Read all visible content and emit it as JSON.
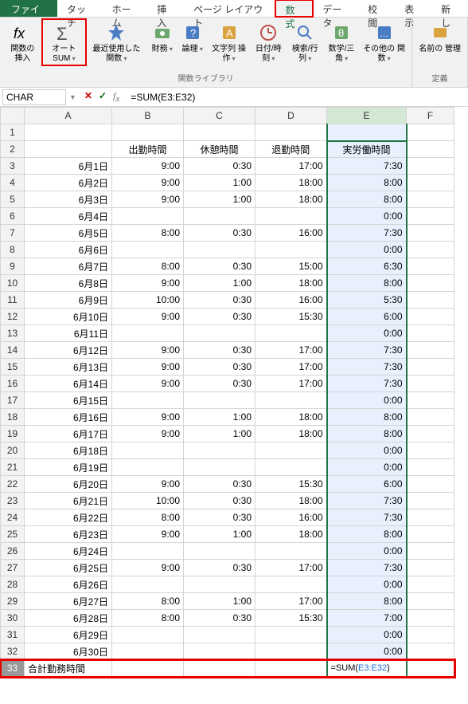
{
  "tabs": {
    "file": "ファイル",
    "touch": "タッチ",
    "home": "ホーム",
    "insert": "挿入",
    "pagelayout": "ページ レイアウト",
    "formulas": "数式",
    "data": "データ",
    "review": "校閲",
    "view": "表示",
    "new": "新し"
  },
  "ribbon": {
    "insert_fn": "関数の\n挿入",
    "autosum": "オート\nSUM",
    "recent": "最近使用した\n関数",
    "finance": "財務",
    "logic": "論理",
    "text": "文字列\n操作",
    "date": "日付/時刻",
    "lookup": "検索/行列",
    "math": "数学/三角",
    "other": "その他の\n関数",
    "name_mgr": "名前の\n管理",
    "define": "定義",
    "group_label": "関数ライブラリ"
  },
  "fbar": {
    "namebox": "CHAR",
    "formula": "=SUM(E3:E32)"
  },
  "cols": {
    "A": "A",
    "B": "B",
    "C": "C",
    "D": "D",
    "E": "E",
    "F": "F"
  },
  "headers": {
    "B": "出勤時間",
    "C": "休憩時間",
    "D": "退勤時間",
    "E": "実労働時間"
  },
  "rows": [
    {
      "n": 1
    },
    {
      "n": 2
    },
    {
      "n": 3,
      "A": "6月1日",
      "B": "9:00",
      "C": "0:30",
      "D": "17:00",
      "E": "7:30"
    },
    {
      "n": 4,
      "A": "6月2日",
      "B": "9:00",
      "C": "1:00",
      "D": "18:00",
      "E": "8:00"
    },
    {
      "n": 5,
      "A": "6月3日",
      "B": "9:00",
      "C": "1:00",
      "D": "18:00",
      "E": "8:00"
    },
    {
      "n": 6,
      "A": "6月4日",
      "E": "0:00"
    },
    {
      "n": 7,
      "A": "6月5日",
      "B": "8:00",
      "C": "0:30",
      "D": "16:00",
      "E": "7:30"
    },
    {
      "n": 8,
      "A": "6月6日",
      "E": "0:00"
    },
    {
      "n": 9,
      "A": "6月7日",
      "B": "8:00",
      "C": "0:30",
      "D": "15:00",
      "E": "6:30"
    },
    {
      "n": 10,
      "A": "6月8日",
      "B": "9:00",
      "C": "1:00",
      "D": "18:00",
      "E": "8:00"
    },
    {
      "n": 11,
      "A": "6月9日",
      "B": "10:00",
      "C": "0:30",
      "D": "16:00",
      "E": "5:30"
    },
    {
      "n": 12,
      "A": "6月10日",
      "B": "9:00",
      "C": "0:30",
      "D": "15:30",
      "E": "6:00"
    },
    {
      "n": 13,
      "A": "6月11日",
      "E": "0:00"
    },
    {
      "n": 14,
      "A": "6月12日",
      "B": "9:00",
      "C": "0:30",
      "D": "17:00",
      "E": "7:30"
    },
    {
      "n": 15,
      "A": "6月13日",
      "B": "9:00",
      "C": "0:30",
      "D": "17:00",
      "E": "7:30"
    },
    {
      "n": 16,
      "A": "6月14日",
      "B": "9:00",
      "C": "0:30",
      "D": "17:00",
      "E": "7:30"
    },
    {
      "n": 17,
      "A": "6月15日",
      "E": "0:00"
    },
    {
      "n": 18,
      "A": "6月16日",
      "B": "9:00",
      "C": "1:00",
      "D": "18:00",
      "E": "8:00"
    },
    {
      "n": 19,
      "A": "6月17日",
      "B": "9:00",
      "C": "1:00",
      "D": "18:00",
      "E": "8:00"
    },
    {
      "n": 20,
      "A": "6月18日",
      "E": "0:00"
    },
    {
      "n": 21,
      "A": "6月19日",
      "E": "0:00"
    },
    {
      "n": 22,
      "A": "6月20日",
      "B": "9:00",
      "C": "0:30",
      "D": "15:30",
      "E": "6:00"
    },
    {
      "n": 23,
      "A": "6月21日",
      "B": "10:00",
      "C": "0:30",
      "D": "18:00",
      "E": "7:30"
    },
    {
      "n": 24,
      "A": "6月22日",
      "B": "8:00",
      "C": "0:30",
      "D": "16:00",
      "E": "7:30"
    },
    {
      "n": 25,
      "A": "6月23日",
      "B": "9:00",
      "C": "1:00",
      "D": "18:00",
      "E": "8:00"
    },
    {
      "n": 26,
      "A": "6月24日",
      "E": "0:00"
    },
    {
      "n": 27,
      "A": "6月25日",
      "B": "9:00",
      "C": "0:30",
      "D": "17:00",
      "E": "7:30"
    },
    {
      "n": 28,
      "A": "6月26日",
      "E": "0:00"
    },
    {
      "n": 29,
      "A": "6月27日",
      "B": "8:00",
      "C": "1:00",
      "D": "17:00",
      "E": "8:00"
    },
    {
      "n": 30,
      "A": "6月28日",
      "B": "8:00",
      "C": "0:30",
      "D": "15:30",
      "E": "7:00"
    },
    {
      "n": 31,
      "A": "6月29日",
      "E": "0:00"
    },
    {
      "n": 32,
      "A": "6月30日",
      "E": "0:00"
    }
  ],
  "row33": {
    "n": 33,
    "A": "合計勤務時間",
    "E_prefix": "=SUM(",
    "E_ref": "E3:E32",
    "E_suffix": ")"
  }
}
